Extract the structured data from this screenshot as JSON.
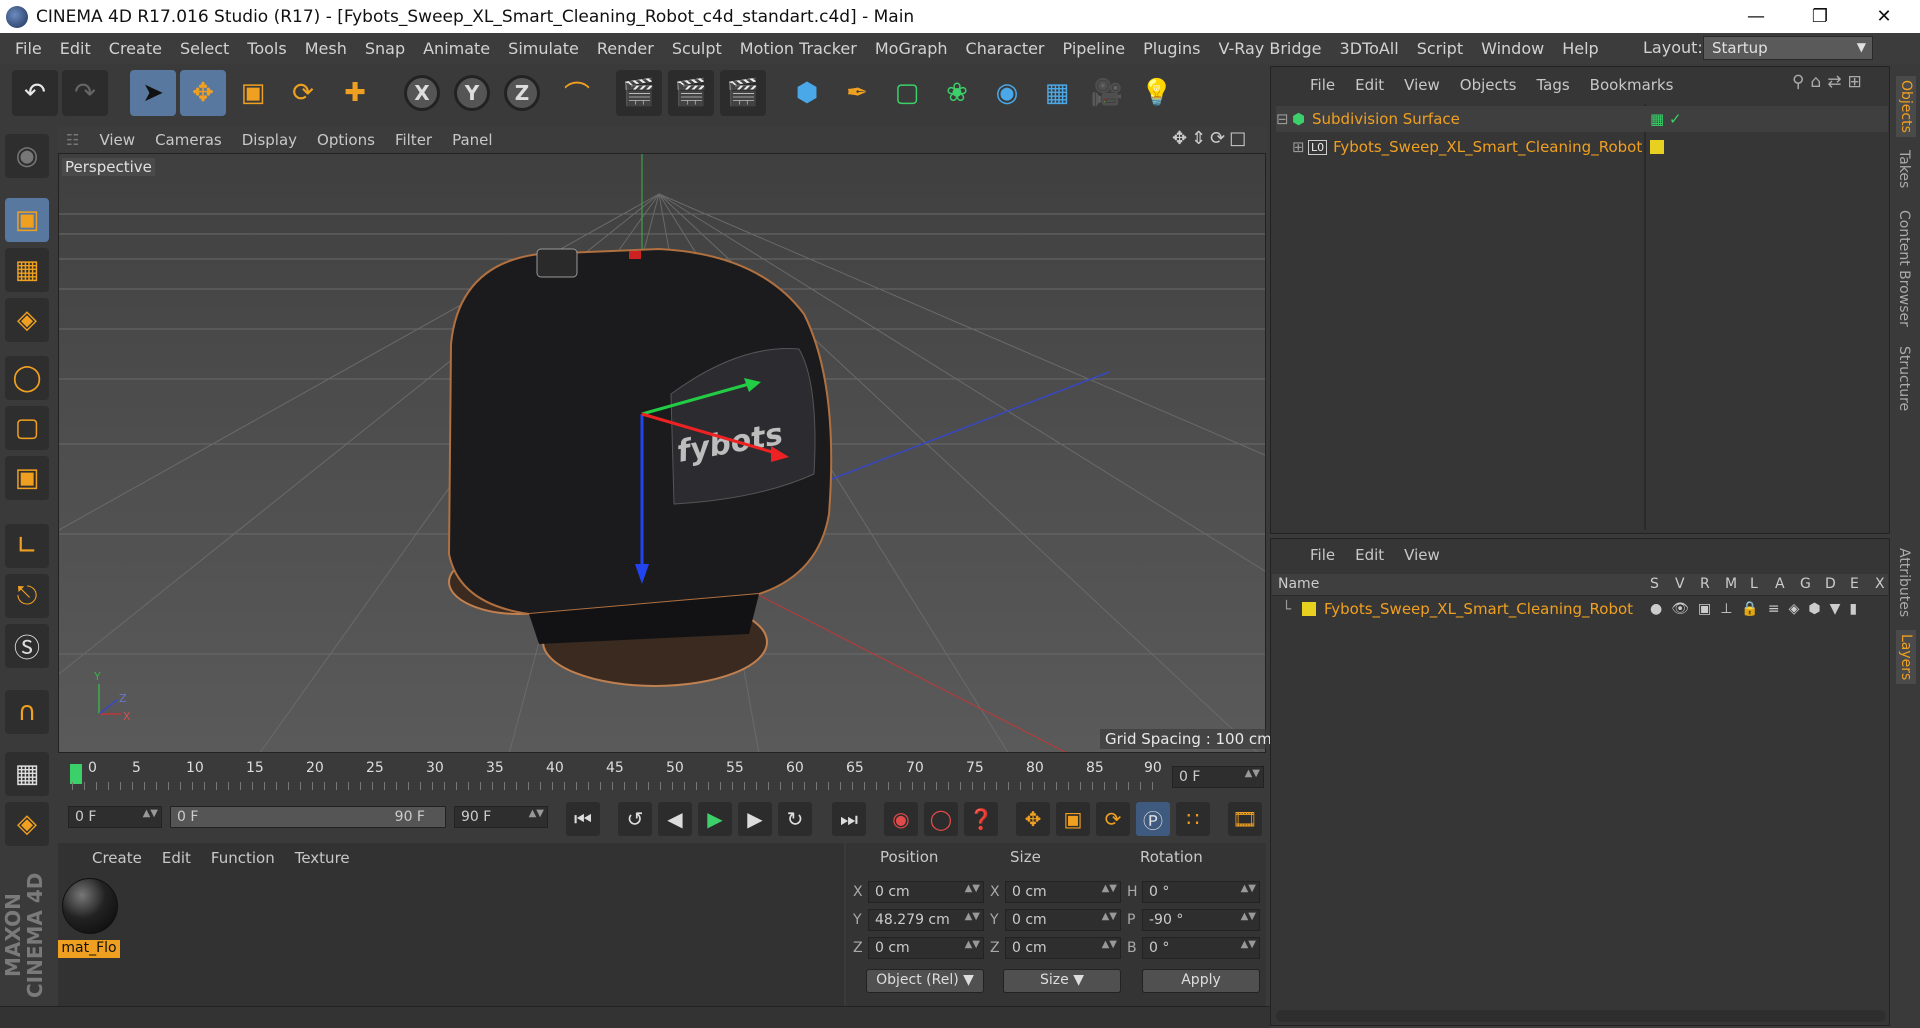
{
  "window": {
    "title": "CINEMA 4D R17.016 Studio (R17) - [Fybots_Sweep_XL_Smart_Cleaning_Robot_c4d_standart.c4d] - Main"
  },
  "menubar": {
    "items": [
      "File",
      "Edit",
      "Create",
      "Select",
      "Tools",
      "Mesh",
      "Snap",
      "Animate",
      "Simulate",
      "Render",
      "Sculpt",
      "Motion Tracker",
      "MoGraph",
      "Character",
      "Pipeline",
      "Plugins",
      "V-Ray Bridge",
      "3DToAll",
      "Script",
      "Window",
      "Help"
    ]
  },
  "layout": {
    "label": "Layout:",
    "value": "Startup"
  },
  "toolbar": {
    "axis_x": "X",
    "axis_y": "Y",
    "axis_z": "Z"
  },
  "viewport": {
    "menu": [
      "View",
      "Cameras",
      "Display",
      "Options",
      "Filter",
      "Panel"
    ],
    "label": "Perspective",
    "grid_spacing": "Grid Spacing : 100 cm",
    "brand_text": "fybots",
    "axis_y": "Y",
    "axis_z": "Z",
    "axis_x": "X"
  },
  "timeline": {
    "ticks": [
      "0",
      "5",
      "10",
      "15",
      "20",
      "25",
      "30",
      "35",
      "40",
      "45",
      "50",
      "55",
      "60",
      "65",
      "70",
      "75",
      "80",
      "85",
      "90"
    ],
    "current_frame": "0 F",
    "start": "0 F",
    "range_left": "0 F",
    "range_right": "90 F",
    "end": "90 F"
  },
  "material_manager": {
    "menu": [
      "Create",
      "Edit",
      "Function",
      "Texture"
    ],
    "material_name": "mat_Flo"
  },
  "coords": {
    "headers": {
      "position": "Position",
      "size": "Size",
      "rotation": "Rotation"
    },
    "pos_x": "0 cm",
    "pos_y": "48.279 cm",
    "pos_z": "0 cm",
    "size_x": "0 cm",
    "size_y": "0 cm",
    "size_z": "0 cm",
    "rot_h": "0 °",
    "rot_p": "-90 °",
    "rot_b": "0 °",
    "lbl_x": "X",
    "lbl_y": "Y",
    "lbl_z": "Z",
    "lbl_h": "H",
    "lbl_p": "P",
    "lbl_b": "B",
    "mode": "Object (Rel)",
    "size_mode": "Size",
    "apply": "Apply"
  },
  "object_manager": {
    "menu": [
      "File",
      "Edit",
      "View",
      "Objects",
      "Tags",
      "Bookmarks"
    ],
    "objects": [
      {
        "name": "Subdivision Surface"
      },
      {
        "name": "Fybots_Sweep_XL_Smart_Cleaning_Robot",
        "badge": "L0"
      }
    ]
  },
  "layer_manager": {
    "menu": [
      "File",
      "Edit",
      "View"
    ],
    "name_header": "Name",
    "columns": [
      "S",
      "V",
      "R",
      "M",
      "L",
      "A",
      "G",
      "D",
      "E",
      "X"
    ],
    "layers": [
      {
        "name": "Fybots_Sweep_XL_Smart_Cleaning_Robot",
        "color": "#e8d020"
      }
    ]
  },
  "right_tabs": [
    "Objects",
    "Takes",
    "Content Browser",
    "Structure",
    "Attributes",
    "Layers"
  ],
  "branding": {
    "maxon": "MAXON CINEMA 4D"
  },
  "colors": {
    "accent": "#f0a020",
    "selected": "#5878a0",
    "layer": "#e8d020"
  }
}
